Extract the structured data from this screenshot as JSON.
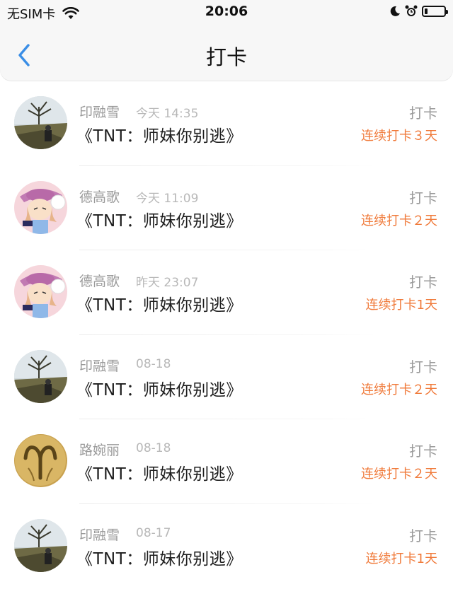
{
  "status_bar": {
    "carrier": "无SIM卡",
    "time": "20:06",
    "battery_level": 0.15
  },
  "nav": {
    "back_icon": "chevron-left-icon",
    "title": "打卡"
  },
  "colors": {
    "accent_back": "#3a8ee6",
    "streak": "#f07a3a",
    "secondary_text": "#9a9a9a"
  },
  "checkins": [
    {
      "user": "印融雪",
      "time": "今天 14:35",
      "book": "《TNT：师妹你别逃》",
      "action": "打卡",
      "streak": "连续打卡３天",
      "avatar": "landscape-avatar"
    },
    {
      "user": "德高歌",
      "time": "今天 11:09",
      "book": "《TNT：师妹你别逃》",
      "action": "打卡",
      "streak": "连续打卡２天",
      "avatar": "anime-girl-avatar"
    },
    {
      "user": "德高歌",
      "time": "昨天 23:07",
      "book": "《TNT：师妹你别逃》",
      "action": "打卡",
      "streak": "连续打卡1天",
      "avatar": "anime-girl-avatar"
    },
    {
      "user": "印融雪",
      "time": "08-18",
      "book": "《TNT：师妹你别逃》",
      "action": "打卡",
      "streak": "连续打卡２天",
      "avatar": "landscape-avatar"
    },
    {
      "user": "路婉丽",
      "time": "08-18",
      "book": "《TNT：师妹你别逃》",
      "action": "打卡",
      "streak": "连续打卡２天",
      "avatar": "aries-symbol-avatar"
    },
    {
      "user": "印融雪",
      "time": "08-17",
      "book": "《TNT：师妹你别逃》",
      "action": "打卡",
      "streak": "连续打卡1天",
      "avatar": "landscape-avatar"
    }
  ]
}
